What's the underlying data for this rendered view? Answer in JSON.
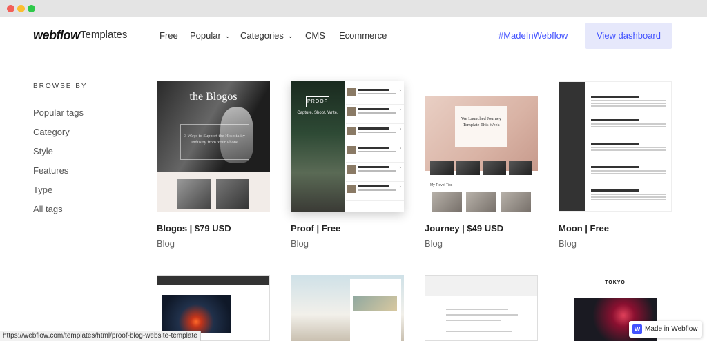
{
  "header": {
    "logo": "webflow",
    "logo_sub": "Templates",
    "nav": {
      "free": "Free",
      "popular": "Popular",
      "categories": "Categories",
      "cms": "CMS",
      "ecommerce": "Ecommerce"
    },
    "made_in_link": "#MadeInWebflow",
    "dashboard_button": "View dashboard"
  },
  "sidebar": {
    "title": "BROWSE BY",
    "items": [
      "Popular tags",
      "Category",
      "Style",
      "Features",
      "Type",
      "All tags"
    ]
  },
  "templates": [
    {
      "title": "Blogos | $79 USD",
      "category": "Blog"
    },
    {
      "title": "Proof | Free",
      "category": "Blog"
    },
    {
      "title": "Journey | $49 USD",
      "category": "Blog"
    },
    {
      "title": "Moon | Free",
      "category": "Blog"
    }
  ],
  "thumbs": {
    "blogos_title": "the Blogos",
    "blogos_box": "3 Ways to Support the Hospitality Industry from Your Phone",
    "proof_badge": "PROOF",
    "proof_tag": "Capture, Shoot, Write.",
    "journey_card": "We Launched Journey Template This Week",
    "journey_tips": "My Travel Tips",
    "tokyo": "TOKYO"
  },
  "status_url": "https://webflow.com/templates/html/proof-blog-website-template",
  "made_in_badge": "Made in Webflow",
  "colors": {
    "accent": "#4353ff",
    "button_bg": "#e6e8fb"
  }
}
